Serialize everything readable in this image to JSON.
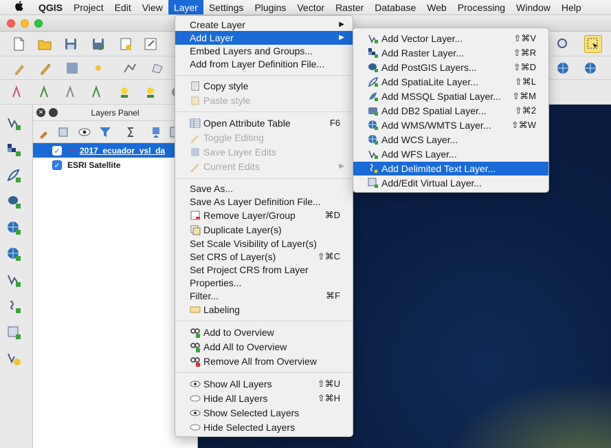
{
  "menubar": {
    "apple": "",
    "items": [
      "QGIS",
      "Project",
      "Edit",
      "View",
      "Layer",
      "Settings",
      "Plugins",
      "Vector",
      "Raster",
      "Database",
      "Web",
      "Processing",
      "Window",
      "Help"
    ]
  },
  "layers_panel": {
    "title": "Layers Panel",
    "close_glyph": "✕",
    "layers": [
      {
        "name": "2017_ecuador_ysl_da",
        "checked": true,
        "selected": true
      },
      {
        "name": "ESRI Satellite",
        "checked": true,
        "selected": false
      }
    ],
    "check_glyph": "✓"
  },
  "layer_menu": {
    "items": [
      {
        "label": "Create Layer",
        "arrow": "▶"
      },
      {
        "label": "Add Layer",
        "arrow": "▶",
        "highlighted": true
      },
      {
        "label": "Embed Layers and Groups..."
      },
      {
        "label": "Add from Layer Definition File..."
      },
      {
        "label": "Copy style",
        "icon": "copy-style-icon"
      },
      {
        "label": "Paste style",
        "icon": "paste-style-icon",
        "disabled": true
      },
      {
        "label": "Open Attribute Table",
        "shortcut": "F6",
        "icon": "attribute-table-icon"
      },
      {
        "label": "Toggle Editing",
        "icon": "pencil-icon",
        "disabled": true
      },
      {
        "label": "Save Layer Edits",
        "icon": "save-edits-icon",
        "disabled": true
      },
      {
        "label": "Current Edits",
        "arrow": "▶",
        "icon": "current-edits-icon",
        "disabled": true
      },
      {
        "label": "Save As..."
      },
      {
        "label": "Save As Layer Definition File..."
      },
      {
        "label": "Remove Layer/Group",
        "shortcut": "⌘D",
        "icon": "remove-layer-icon"
      },
      {
        "label": "Duplicate Layer(s)",
        "icon": "duplicate-layer-icon"
      },
      {
        "label": "Set Scale Visibility of Layer(s)"
      },
      {
        "label": "Set CRS of Layer(s)",
        "shortcut": "⇧⌘C"
      },
      {
        "label": "Set Project CRS from Layer"
      },
      {
        "label": "Properties..."
      },
      {
        "label": "Filter...",
        "shortcut": "⌘F"
      },
      {
        "label": "Labeling",
        "icon": "labeling-icon"
      },
      {
        "label": "Add to Overview",
        "icon": "add-overview-icon"
      },
      {
        "label": "Add All to Overview",
        "icon": "add-all-overview-icon"
      },
      {
        "label": "Remove All from Overview",
        "icon": "remove-overview-icon"
      },
      {
        "label": "Show All Layers",
        "shortcut": "⇧⌘U",
        "icon": "eye-icon"
      },
      {
        "label": "Hide All Layers",
        "shortcut": "⇧⌘H",
        "icon": "eye-closed-icon"
      },
      {
        "label": "Show Selected Layers",
        "icon": "eye-icon"
      },
      {
        "label": "Hide Selected Layers",
        "icon": "eye-closed-icon"
      }
    ]
  },
  "add_layer_submenu": {
    "items": [
      {
        "label": "Add Vector Layer...",
        "shortcut": "⇧⌘V",
        "icon": "vector-layer-icon"
      },
      {
        "label": "Add Raster Layer...",
        "shortcut": "⇧⌘R",
        "icon": "raster-layer-icon"
      },
      {
        "label": "Add PostGIS Layers...",
        "shortcut": "⇧⌘D",
        "icon": "postgis-icon"
      },
      {
        "label": "Add SpatiaLite Layer...",
        "shortcut": "⇧⌘L",
        "icon": "spatialite-icon"
      },
      {
        "label": "Add MSSQL Spatial Layer...",
        "shortcut": "⇧⌘M",
        "icon": "mssql-icon"
      },
      {
        "label": "Add DB2 Spatial Layer...",
        "shortcut": "⇧⌘2",
        "icon": "db2-icon"
      },
      {
        "label": "Add WMS/WMTS Layer...",
        "shortcut": "⇧⌘W",
        "icon": "wms-icon"
      },
      {
        "label": "Add WCS Layer...",
        "icon": "wcs-icon"
      },
      {
        "label": "Add WFS Layer...",
        "icon": "wfs-icon"
      },
      {
        "label": "Add Delimited Text Layer...",
        "icon": "delimited-text-icon",
        "highlighted": true
      },
      {
        "label": "Add/Edit Virtual Layer...",
        "icon": "virtual-layer-icon"
      }
    ]
  },
  "colors": {
    "accent": "#1a6ad7",
    "map_ocean": "#0b1f44"
  }
}
